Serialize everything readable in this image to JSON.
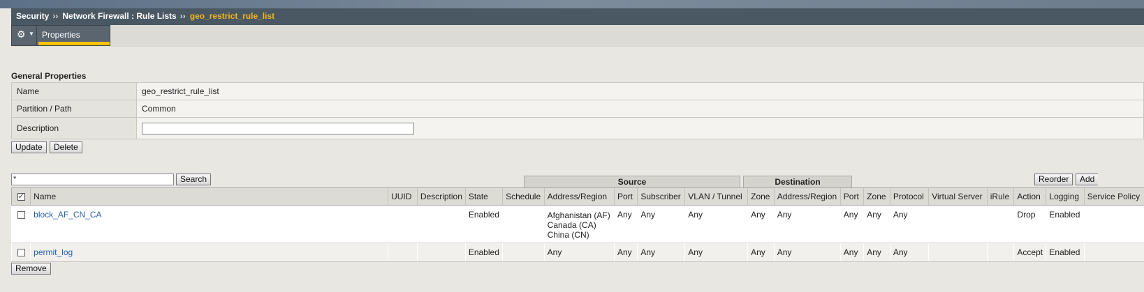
{
  "breadcrumb": {
    "item1": "Security",
    "item2": "Network Firewall : Rule Lists",
    "current": "geo_restrict_rule_list",
    "separator": "››"
  },
  "tabs": {
    "properties": "Properties"
  },
  "general": {
    "title": "General Properties",
    "name_label": "Name",
    "name_value": "geo_restrict_rule_list",
    "partition_label": "Partition / Path",
    "partition_value": "Common",
    "description_label": "Description",
    "description_value": ""
  },
  "buttons": {
    "update": "Update",
    "delete": "Delete",
    "search": "Search",
    "reorder": "Reorder",
    "add": "Add",
    "remove": "Remove"
  },
  "search": {
    "value": "*"
  },
  "groups": {
    "source": "Source",
    "destination": "Destination"
  },
  "columns": {
    "name": "Name",
    "uuid": "UUID",
    "description": "Description",
    "state": "State",
    "schedule": "Schedule",
    "src_address": "Address/Region",
    "src_port": "Port",
    "subscriber": "Subscriber",
    "vlan": "VLAN / Tunnel",
    "src_zone": "Zone",
    "dst_address": "Address/Region",
    "dst_port": "Port",
    "dst_zone": "Zone",
    "protocol": "Protocol",
    "virtual_server": "Virtual Server",
    "irule": "iRule",
    "action": "Action",
    "logging": "Logging",
    "service_policy": "Service Policy"
  },
  "rows": [
    {
      "name": "block_AF_CN_CA",
      "uuid": "",
      "description": "",
      "state": "Enabled",
      "schedule": "",
      "src_address": [
        "Afghanistan (AF)",
        "Canada (CA)",
        "China (CN)"
      ],
      "src_port": "Any",
      "subscriber": "Any",
      "vlan": "Any",
      "src_zone": "Any",
      "dst_address": "Any",
      "dst_port": "Any",
      "dst_zone": "Any",
      "protocol": "Any",
      "virtual_server": "",
      "irule": "",
      "action": "Drop",
      "logging": "Enabled",
      "service_policy": ""
    },
    {
      "name": "permit_log",
      "uuid": "",
      "description": "",
      "state": "Enabled",
      "schedule": "",
      "src_address": [
        "Any"
      ],
      "src_port": "Any",
      "subscriber": "Any",
      "vlan": "Any",
      "src_zone": "Any",
      "dst_address": "Any",
      "dst_port": "Any",
      "dst_zone": "Any",
      "protocol": "Any",
      "virtual_server": "",
      "irule": "",
      "action": "Accept",
      "logging": "Enabled",
      "service_policy": ""
    }
  ],
  "icons": {
    "gear": "gear-icon",
    "caret": "chevron-down-icon",
    "checkbox": "checkbox-icon"
  },
  "colors": {
    "breadcrumb_bg": "#4a5864",
    "current_crumb": "#f4b41a",
    "tab_underline": "#f6c20b",
    "link": "#2c5fa8"
  }
}
